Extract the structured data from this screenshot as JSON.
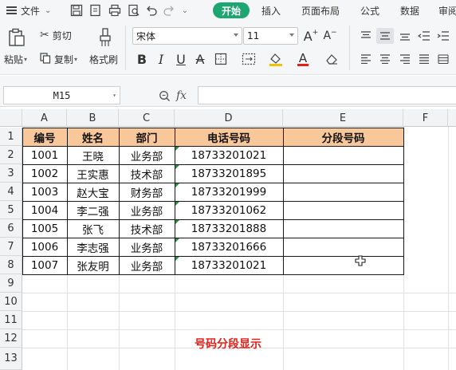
{
  "menubar": {
    "file": "文件",
    "tabs": [
      "开始",
      "插入",
      "页面布局",
      "公式",
      "数据",
      "审阅"
    ]
  },
  "ribbon": {
    "paste": "粘贴",
    "cut": "剪切",
    "copy": "复制",
    "format_painter": "格式刷",
    "font_name": "宋体",
    "font_size": "11"
  },
  "formula_bar": {
    "name_box": "M15",
    "fx": "fx",
    "content": ""
  },
  "sheet": {
    "columns": [
      "A",
      "B",
      "C",
      "D",
      "E",
      "F"
    ],
    "rows": [
      "1",
      "2",
      "3",
      "4",
      "5",
      "6",
      "7",
      "8",
      "9",
      "10",
      "11",
      "12",
      "13"
    ],
    "headers": [
      "编号",
      "姓名",
      "部门",
      "电话号码",
      "分段号码"
    ],
    "records": [
      [
        "1001",
        "王晓",
        "业务部",
        "18733201021",
        ""
      ],
      [
        "1002",
        "王实惠",
        "技术部",
        "18733201895",
        ""
      ],
      [
        "1003",
        "赵大宝",
        "财务部",
        "18733201999",
        ""
      ],
      [
        "1004",
        "李二强",
        "业务部",
        "18733201062",
        ""
      ],
      [
        "1005",
        "张飞",
        "技术部",
        "18733201888",
        ""
      ],
      [
        "1006",
        "李志强",
        "业务部",
        "18733201666",
        ""
      ],
      [
        "1007",
        "张友明",
        "业务部",
        "18733201021",
        ""
      ]
    ],
    "caption": "号码分段显示"
  },
  "colors": {
    "accent": "#1ea672",
    "header_fill": "#f8c79a",
    "caption": "#e0221b"
  }
}
